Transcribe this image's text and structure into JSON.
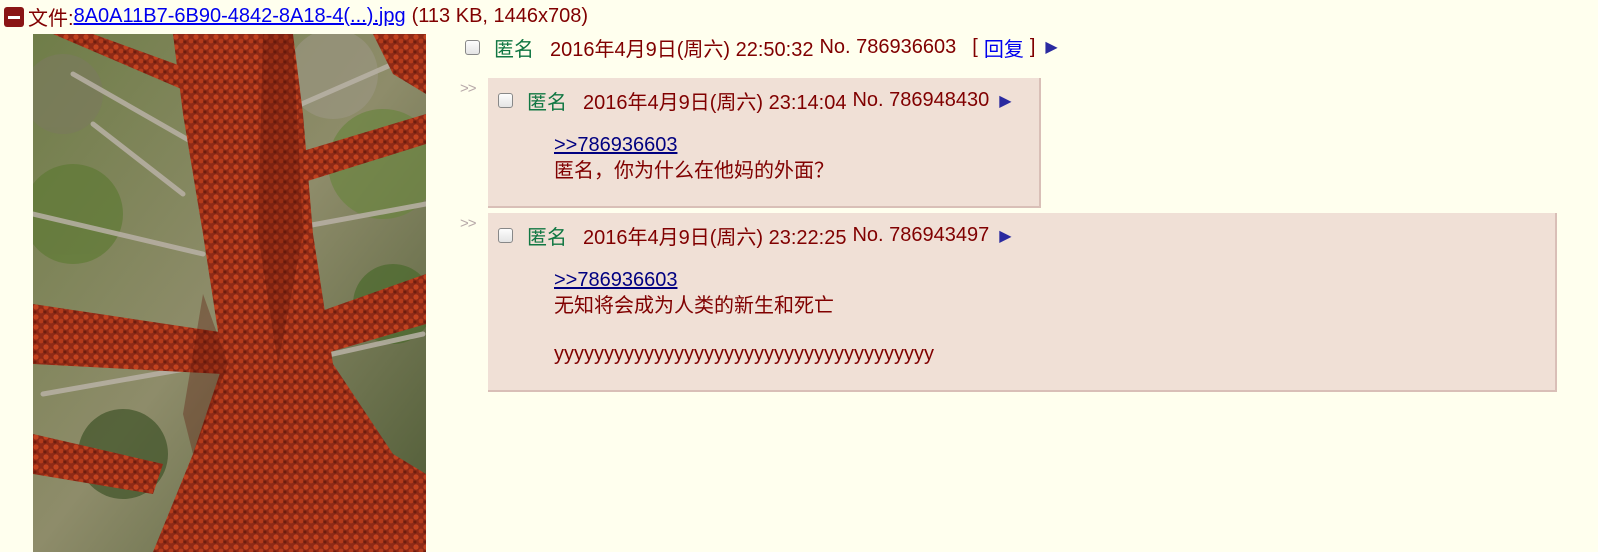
{
  "file": {
    "label": "文件:",
    "name": "8A0A11B7-6B90-4842-8A18-4(...).jpg",
    "meta": "(113 KB, 1446x708)"
  },
  "op": {
    "name": "匿名",
    "datetime": "2016年4月9日(周六) 22:50:32",
    "no": "No. 786936603",
    "reply_open": "[",
    "reply_label": "回复",
    "reply_close": "]",
    "arrow": "▶"
  },
  "replies": [
    {
      "marker": ">>",
      "name": "匿名",
      "datetime": "2016年4月9日(周六) 23:14:04",
      "no": "No. 786948430",
      "arrow": "▶",
      "quote": ">>786936603",
      "lines": [
        "匿名，你为什么在他妈的外面？"
      ]
    },
    {
      "marker": ">>",
      "name": "匿名",
      "datetime": "2016年4月9日(周六) 23:22:25",
      "no": "No. 786943497",
      "arrow": "▶",
      "quote": ">>786936603",
      "lines": [
        "无知将会成为人类的新生和死亡",
        "",
        "yyyyyyyyyyyyyyyyyyyyyyyyyyyyyyyyyyyyyy"
      ]
    }
  ],
  "colors": {
    "background": "#ffffee",
    "reply_bg": "#f0e0d6",
    "name": "#117743",
    "text": "#800000",
    "link": "#0000ee"
  }
}
